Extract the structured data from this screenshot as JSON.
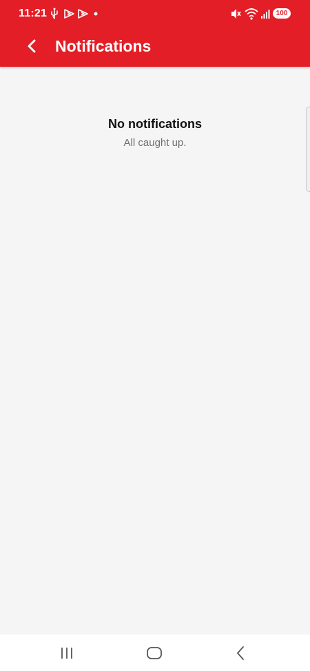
{
  "status_bar": {
    "time": "11:21",
    "battery": "100",
    "left_icons": [
      "usb-icon",
      "play-icon",
      "play-icon",
      "dot-icon"
    ],
    "right_icons": [
      "mute-icon",
      "wifi-icon",
      "signal-icon",
      "battery-icon"
    ]
  },
  "header": {
    "title": "Notifications",
    "back_icon": "chevron-left-icon",
    "color": "#e31e26"
  },
  "empty_state": {
    "title": "No notifications",
    "subtitle": "All caught up."
  },
  "nav_bar": {
    "buttons": [
      "recent-apps-icon",
      "home-icon",
      "back-icon"
    ]
  }
}
